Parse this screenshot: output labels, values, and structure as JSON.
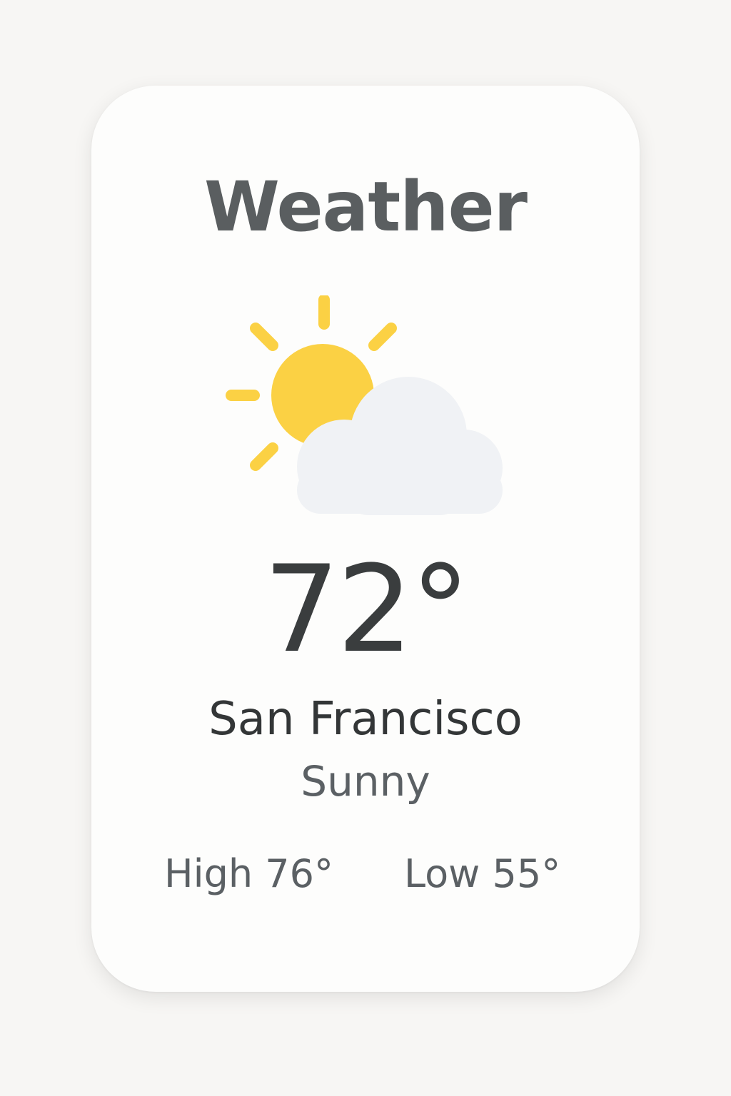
{
  "widget": {
    "title": "Weather",
    "icon": "partly-sunny-icon",
    "temperature": "72°",
    "city": "San Francisco",
    "condition": "Sunny",
    "high": "High 76°",
    "low": "Low 55°"
  },
  "colors": {
    "background": "#f7f6f4",
    "card": "#fdfdfc",
    "title": "#5a5e60",
    "temperature": "#3a3d3e",
    "city": "#333637",
    "secondary": "#5b6064",
    "sun": "#fbd144",
    "cloud": "#f0f2f5"
  }
}
